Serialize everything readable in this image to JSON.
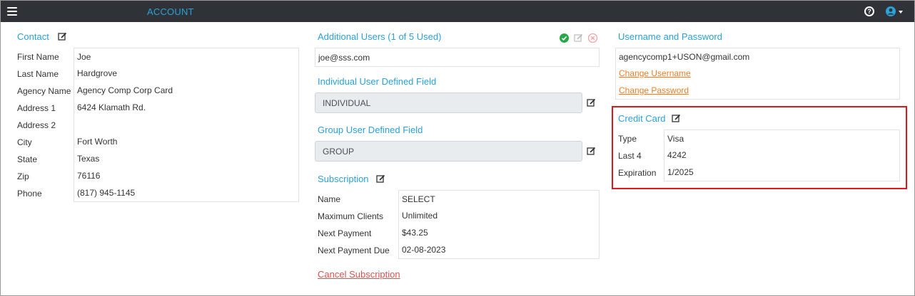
{
  "header": {
    "title": "ACCOUNT"
  },
  "contact": {
    "title": "Contact",
    "fields": [
      {
        "label": "First Name",
        "value": "Joe"
      },
      {
        "label": "Last Name",
        "value": "Hardgrove"
      },
      {
        "label": "Agency Name",
        "value": "Agency Comp Corp Card"
      },
      {
        "label": "Address 1",
        "value": "6424 Klamath Rd."
      },
      {
        "label": "Address 2",
        "value": ""
      },
      {
        "label": "City",
        "value": "Fort Worth"
      },
      {
        "label": "State",
        "value": "Texas"
      },
      {
        "label": "Zip",
        "value": "76116"
      },
      {
        "label": "Phone",
        "value": "(817) 945-1145"
      }
    ]
  },
  "additional_users": {
    "title": "Additional Users (1 of 5 Used)",
    "users": [
      "joe@sss.com"
    ]
  },
  "individual_field": {
    "title": "Individual User Defined Field",
    "value": "INDIVIDUAL"
  },
  "group_field": {
    "title": "Group User Defined Field",
    "value": "GROUP"
  },
  "subscription": {
    "title": "Subscription",
    "fields": [
      {
        "label": "Name",
        "value": "SELECT"
      },
      {
        "label": "Maximum Clients",
        "value": "Unlimited"
      },
      {
        "label": "Next Payment",
        "value": "$43.25"
      },
      {
        "label": "Next Payment Due",
        "value": "02-08-2023"
      }
    ],
    "cancel_label": "Cancel Subscription"
  },
  "credentials": {
    "title": "Username and Password",
    "username": "agencycomp1+USON@gmail.com",
    "change_username": "Change Username",
    "change_password": "Change Password"
  },
  "credit_card": {
    "title": "Credit Card",
    "fields": [
      {
        "label": "Type",
        "value": "Visa"
      },
      {
        "label": "Last 4",
        "value": "4242"
      },
      {
        "label": "Expiration",
        "value": "1/2025"
      }
    ]
  },
  "colors": {
    "accent": "#2aa1d8",
    "topbar": "#2f3338",
    "link_orange": "#f07c20",
    "link_red": "#d9534f",
    "highlight": "#e3161b",
    "success": "#28a745"
  }
}
